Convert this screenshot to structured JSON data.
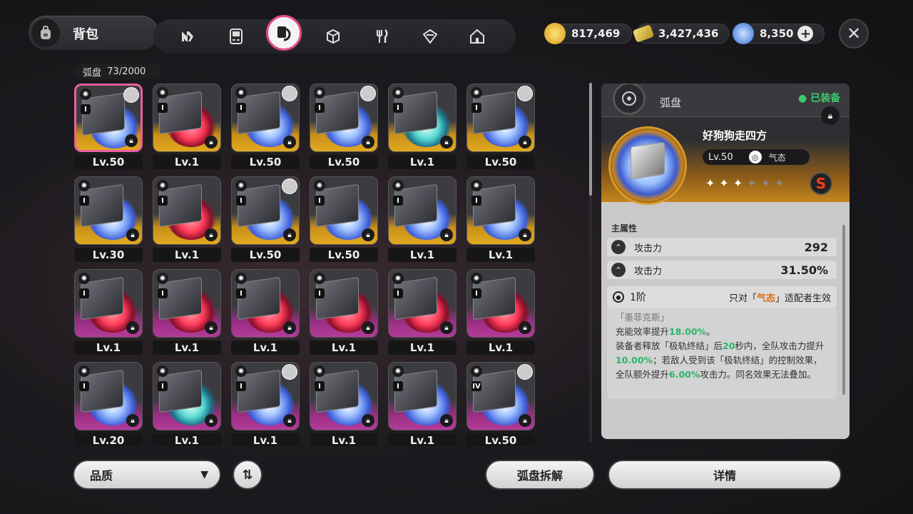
{
  "header": {
    "title": "背包",
    "tabs": [
      {
        "icon": "n-logo-icon"
      },
      {
        "icon": "gameboy-icon"
      },
      {
        "icon": "disc-case-icon",
        "active": true
      },
      {
        "icon": "cube-icon"
      },
      {
        "icon": "fork-knife-icon"
      },
      {
        "icon": "drive-icon"
      },
      {
        "icon": "home-icon"
      }
    ],
    "currencies": [
      {
        "name": "coin",
        "value": "817,469"
      },
      {
        "name": "ticket",
        "value": "3,427,436"
      },
      {
        "name": "crystal",
        "value": "8,350"
      }
    ]
  },
  "inventory": {
    "label": "弧盘",
    "count": "73/2000",
    "items": [
      {
        "level": "Lv.50",
        "rarity": "gold",
        "disc": "blue",
        "avatar": true,
        "selected": true
      },
      {
        "level": "Lv.1",
        "rarity": "gold",
        "disc": "red"
      },
      {
        "level": "Lv.50",
        "rarity": "gold",
        "disc": "blue",
        "avatar": true
      },
      {
        "level": "Lv.50",
        "rarity": "gold",
        "disc": "blue",
        "avatar": true
      },
      {
        "level": "Lv.1",
        "rarity": "gold",
        "disc": "teal"
      },
      {
        "level": "Lv.50",
        "rarity": "gold",
        "disc": "blue",
        "avatar": true
      },
      {
        "level": "Lv.30",
        "rarity": "gold",
        "disc": "blue"
      },
      {
        "level": "Lv.1",
        "rarity": "gold",
        "disc": "red"
      },
      {
        "level": "Lv.50",
        "rarity": "gold",
        "disc": "blue",
        "avatar": true
      },
      {
        "level": "Lv.50",
        "rarity": "gold",
        "disc": "blue"
      },
      {
        "level": "Lv.1",
        "rarity": "gold",
        "disc": "blue"
      },
      {
        "level": "Lv.1",
        "rarity": "gold",
        "disc": "blue"
      },
      {
        "level": "Lv.1",
        "rarity": "purple",
        "disc": "red"
      },
      {
        "level": "Lv.1",
        "rarity": "purple",
        "disc": "red"
      },
      {
        "level": "Lv.1",
        "rarity": "purple",
        "disc": "red"
      },
      {
        "level": "Lv.1",
        "rarity": "purple",
        "disc": "red"
      },
      {
        "level": "Lv.1",
        "rarity": "purple",
        "disc": "red"
      },
      {
        "level": "Lv.1",
        "rarity": "purple",
        "disc": "red"
      },
      {
        "level": "Lv.20",
        "rarity": "purple",
        "disc": "blue"
      },
      {
        "level": "Lv.1",
        "rarity": "purple",
        "disc": "teal"
      },
      {
        "level": "Lv.1",
        "rarity": "purple",
        "disc": "blue",
        "avatar": true
      },
      {
        "level": "Lv.1",
        "rarity": "purple",
        "disc": "blue"
      },
      {
        "level": "Lv.1",
        "rarity": "purple",
        "disc": "blue"
      },
      {
        "level": "Lv.50",
        "rarity": "purple",
        "disc": "blue",
        "rank": "IV",
        "avatar": true
      }
    ]
  },
  "detail": {
    "category": "弧盘",
    "equipped": "已装备",
    "name": "好狗狗走四方",
    "level": "Lv.50",
    "attribute": "气态",
    "stars_filled": 3,
    "stars_total": 6,
    "grade": "S",
    "main_label": "主属性",
    "stats": [
      {
        "name": "攻击力",
        "value": "292"
      },
      {
        "name": "攻击力",
        "value": "31.50%"
      }
    ],
    "tier": "1阶",
    "restrict_prefix": "只对「",
    "restrict_attr": "气态",
    "restrict_suffix": "」适配者生效",
    "effect_title": "「墨菲克斯」",
    "effect_line1_a": "充能效率提升",
    "effect_line1_b": "18.00%",
    "effect_line1_c": "。",
    "effect_line2_a": "装备者释放「极轨终结」后",
    "effect_line2_b": "20",
    "effect_line2_c": "秒内，全队攻击力提升",
    "effect_line2_d": "10.00%",
    "effect_line2_e": "；若敌人受到该「极轨终结」的控制效果，全队额外提升",
    "effect_line2_f": "6.00%",
    "effect_line2_g": "攻击力。同名效果无法叠加。"
  },
  "footer": {
    "sort_label": "品质",
    "dismantle_label": "弧盘拆解",
    "detail_label": "详情"
  }
}
